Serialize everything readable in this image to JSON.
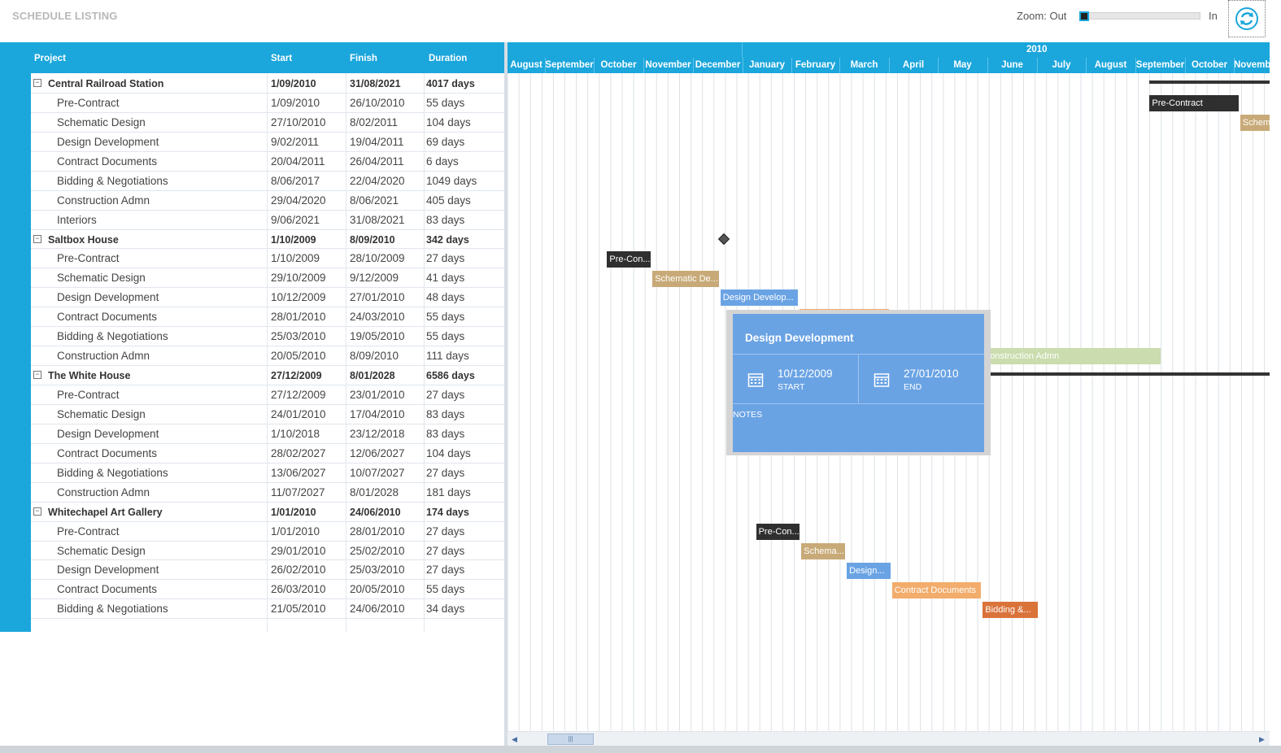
{
  "app": {
    "title": "SCHEDULE LISTING"
  },
  "zoom": {
    "out_label": "Zoom: Out",
    "in_label": "In",
    "level": 0.03
  },
  "refresh": {
    "icon": "refresh-icon"
  },
  "grid": {
    "columns": [
      "Project",
      "Start",
      "Finish",
      "Duration"
    ],
    "rows": [
      {
        "type": "parent",
        "name": "Central Railroad Station",
        "start": "1/09/2010",
        "finish": "31/08/2021",
        "duration": "4017 days"
      },
      {
        "type": "child",
        "name": "Pre-Contract",
        "start": "1/09/2010",
        "finish": "26/10/2010",
        "duration": "55 days"
      },
      {
        "type": "child",
        "name": "Schematic Design",
        "start": "27/10/2010",
        "finish": "8/02/2011",
        "duration": "104 days"
      },
      {
        "type": "child",
        "name": "Design Development",
        "start": "9/02/2011",
        "finish": "19/04/2011",
        "duration": "69 days"
      },
      {
        "type": "child",
        "name": "Contract Documents",
        "start": "20/04/2011",
        "finish": "26/04/2011",
        "duration": "6 days"
      },
      {
        "type": "child",
        "name": "Bidding & Negotiations",
        "start": "8/06/2017",
        "finish": "22/04/2020",
        "duration": "1049 days"
      },
      {
        "type": "child",
        "name": "Construction Admn",
        "start": "29/04/2020",
        "finish": "8/06/2021",
        "duration": "405 days"
      },
      {
        "type": "child",
        "name": "Interiors",
        "start": "9/06/2021",
        "finish": "31/08/2021",
        "duration": "83 days"
      },
      {
        "type": "parent",
        "name": "Saltbox House",
        "start": "1/10/2009",
        "finish": "8/09/2010",
        "duration": "342 days"
      },
      {
        "type": "child",
        "name": "Pre-Contract",
        "start": "1/10/2009",
        "finish": "28/10/2009",
        "duration": "27 days"
      },
      {
        "type": "child",
        "name": "Schematic Design",
        "start": "29/10/2009",
        "finish": "9/12/2009",
        "duration": "41 days"
      },
      {
        "type": "child",
        "name": "Design Development",
        "start": "10/12/2009",
        "finish": "27/01/2010",
        "duration": "48 days"
      },
      {
        "type": "child",
        "name": "Contract Documents",
        "start": "28/01/2010",
        "finish": "24/03/2010",
        "duration": "55 days"
      },
      {
        "type": "child",
        "name": "Bidding & Negotiations",
        "start": "25/03/2010",
        "finish": "19/05/2010",
        "duration": "55 days"
      },
      {
        "type": "child",
        "name": "Construction Admn",
        "start": "20/05/2010",
        "finish": "8/09/2010",
        "duration": "111 days"
      },
      {
        "type": "parent",
        "name": "The White House",
        "start": "27/12/2009",
        "finish": "8/01/2028",
        "duration": "6586 days"
      },
      {
        "type": "child",
        "name": "Pre-Contract",
        "start": "27/12/2009",
        "finish": "23/01/2010",
        "duration": "27 days"
      },
      {
        "type": "child",
        "name": "Schematic Design",
        "start": "24/01/2010",
        "finish": "17/04/2010",
        "duration": "83 days"
      },
      {
        "type": "child",
        "name": "Design Development",
        "start": "1/10/2018",
        "finish": "23/12/2018",
        "duration": "83 days"
      },
      {
        "type": "child",
        "name": "Contract Documents",
        "start": "28/02/2027",
        "finish": "12/06/2027",
        "duration": "104 days"
      },
      {
        "type": "child",
        "name": "Bidding & Negotiations",
        "start": "13/06/2027",
        "finish": "10/07/2027",
        "duration": "27 days"
      },
      {
        "type": "child",
        "name": "Construction Admn",
        "start": "11/07/2027",
        "finish": "8/01/2028",
        "duration": "181 days"
      },
      {
        "type": "parent",
        "name": "Whitechapel Art Gallery",
        "start": "1/01/2010",
        "finish": "24/06/2010",
        "duration": "174 days"
      },
      {
        "type": "child",
        "name": "Pre-Contract",
        "start": "1/01/2010",
        "finish": "28/01/2010",
        "duration": "27 days"
      },
      {
        "type": "child",
        "name": "Schematic Design",
        "start": "29/01/2010",
        "finish": "25/02/2010",
        "duration": "27 days"
      },
      {
        "type": "child",
        "name": "Design Development",
        "start": "26/02/2010",
        "finish": "25/03/2010",
        "duration": "27 days"
      },
      {
        "type": "child",
        "name": "Contract Documents",
        "start": "26/03/2010",
        "finish": "20/05/2010",
        "duration": "55 days"
      },
      {
        "type": "child",
        "name": "Bidding & Negotiations",
        "start": "21/05/2010",
        "finish": "24/06/2010",
        "duration": "34 days"
      }
    ]
  },
  "timeline": {
    "year": "2010",
    "months": [
      "August",
      "September",
      "October",
      "November",
      "December",
      "January",
      "February",
      "March",
      "April",
      "May",
      "June",
      "July",
      "August",
      "September",
      "October",
      "November"
    ]
  },
  "gantt": {
    "bars": [
      {
        "row": 1,
        "label": "Pre-Contract",
        "color": "#2f2f2f",
        "start": "1/09/2010",
        "end": "26/10/2010"
      },
      {
        "row": 2,
        "label": "Schematic",
        "color": "#c8aa78",
        "start": "27/10/2010",
        "end": "8/02/2011"
      },
      {
        "row": 9,
        "label": "Pre-Con...",
        "color": "#2f2f2f",
        "start": "1/10/2009",
        "end": "28/10/2009"
      },
      {
        "row": 10,
        "label": "Schematic De...",
        "color": "#c8aa78",
        "start": "29/10/2009",
        "end": "9/12/2009"
      },
      {
        "row": 11,
        "label": "Design Develop...",
        "color": "#6aa3e4",
        "start": "10/12/2009",
        "end": "27/01/2010"
      },
      {
        "row": 12,
        "label": "",
        "color": "#f2ac6b",
        "start": "28/01/2010",
        "end": "24/03/2010"
      },
      {
        "row": 14,
        "label": "Construction Admn",
        "color": "#cbdcae",
        "start": "20/05/2010",
        "end": "8/09/2010"
      },
      {
        "row": 23,
        "label": "Pre-Con...",
        "color": "#2f2f2f",
        "start": "1/01/2010",
        "end": "28/01/2010"
      },
      {
        "row": 24,
        "label": "Schema...",
        "color": "#c8aa78",
        "start": "29/01/2010",
        "end": "25/02/2010"
      },
      {
        "row": 25,
        "label": "Design...",
        "color": "#6aa3e4",
        "start": "26/02/2010",
        "end": "25/03/2010"
      },
      {
        "row": 26,
        "label": "Contract Documents",
        "color": "#f2ac6b",
        "start": "26/03/2010",
        "end": "20/05/2010"
      },
      {
        "row": 27,
        "label": "Bidding &...",
        "color": "#d9733a",
        "start": "21/05/2010",
        "end": "24/06/2010"
      }
    ],
    "milestone_row": 8
  },
  "tooltip": {
    "title": "Design Development",
    "start_date": "10/12/2009",
    "start_label": "START",
    "end_date": "27/01/2010",
    "end_label": "END",
    "notes_label": "NOTES",
    "icon": "calendar-icon"
  },
  "colors": {
    "accent": "#1ba6dc",
    "tooltip": "#6aa3e4"
  }
}
